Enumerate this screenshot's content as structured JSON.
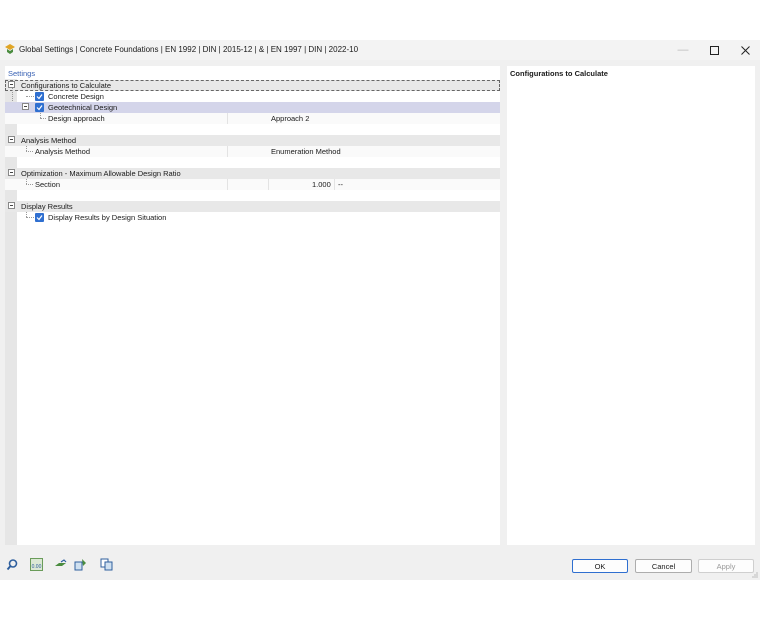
{
  "window": {
    "title": "Global Settings | Concrete Foundations | EN 1992 | DIN | 2015-12 | & | EN 1997 | DIN | 2022-10"
  },
  "left_panel": {
    "header": "Settings",
    "sections": [
      {
        "label": "Configurations to Calculate"
      },
      {
        "label": "Analysis Method"
      },
      {
        "label": "Optimization - Maximum Allowable Design Ratio"
      },
      {
        "label": "Display Results"
      }
    ],
    "items": {
      "concrete_design": {
        "label": "Concrete Design",
        "checked": true
      },
      "geotechnical_design": {
        "label": "Geotechnical Design",
        "checked": true
      },
      "design_approach": {
        "label": "Design approach",
        "value": "Approach 2"
      },
      "analysis_method": {
        "label": "Analysis Method",
        "value": "Enumeration Method"
      },
      "section": {
        "label": "Section",
        "value": "1.000",
        "unit": "--"
      },
      "display_by_situation": {
        "label": "Display Results by Design Situation",
        "checked": true
      }
    }
  },
  "right_panel": {
    "title": "Configurations to Calculate"
  },
  "buttons": {
    "ok": "OK",
    "cancel": "Cancel",
    "apply": "Apply"
  },
  "bottom_icons": [
    "search-icon",
    "units-icon",
    "model-icon",
    "settings-icon",
    "copy-icon"
  ]
}
